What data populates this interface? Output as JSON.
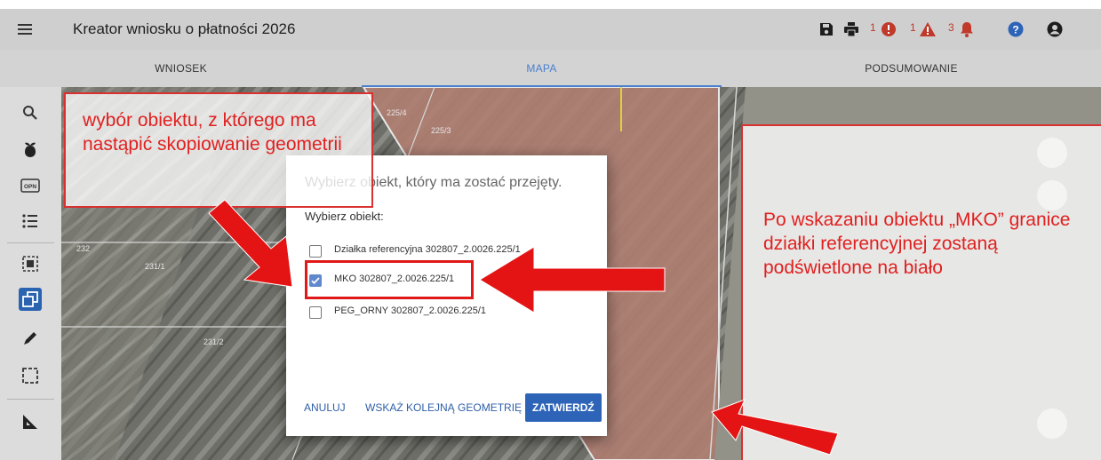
{
  "header": {
    "title": "Kreator wniosku o płatności 2026",
    "counts": {
      "errors": "1",
      "warnings": "1",
      "notifications": "3"
    },
    "icons": [
      "menu-icon",
      "save-icon",
      "print-icon",
      "error-icon",
      "warning-icon",
      "bell-icon",
      "help-icon",
      "account-icon"
    ]
  },
  "tabs": [
    {
      "label": "WNIOSEK"
    },
    {
      "label": "MAPA"
    },
    {
      "label": "PODSUMOWANIE"
    }
  ],
  "active_tab": "MAPA",
  "toolbar": {
    "tools": [
      "search-icon",
      "plant-icon",
      "opn-icon",
      "list-icon",
      "select-area-icon",
      "copy-geometry-icon",
      "pencil-icon",
      "rectangle-select-icon",
      "measure-icon"
    ],
    "opn_text": "OPN",
    "active_tool": "copy-geometry-icon"
  },
  "map": {
    "parcel_labels": [
      "225/4",
      "225/3",
      "232",
      "231/1",
      "231/2"
    ],
    "controls": [
      "layers-icon",
      "info-icon",
      "fullscreen-icon"
    ]
  },
  "dialog": {
    "title": "Wybierz obiekt, który ma zostać przejęty.",
    "label": "Wybierz obiekt:",
    "options": [
      {
        "label": "Działka referencyjna 302807_2.0026.225/1",
        "checked": false
      },
      {
        "label": "MKO 302807_2.0026.225/1",
        "checked": true
      },
      {
        "label": "PEG_ORNY 302807_2.0026.225/1",
        "checked": false
      }
    ],
    "buttons": {
      "cancel": "ANULUJ",
      "next": "WSKAŻ KOLEJNĄ GEOMETRIĘ",
      "confirm": "ZATWIERDŹ"
    }
  },
  "annotations": {
    "left": "wybór obiektu, z którego ma nastąpić skopiowanie geometrii",
    "right": "Po wskazaniu obiektu „MKO” granice działki referencyjnej zostaną podświetlone na biało"
  },
  "colors": {
    "accent": "#2d64b8",
    "annotation_red": "#e02020",
    "alert_red": "#c0392b"
  }
}
